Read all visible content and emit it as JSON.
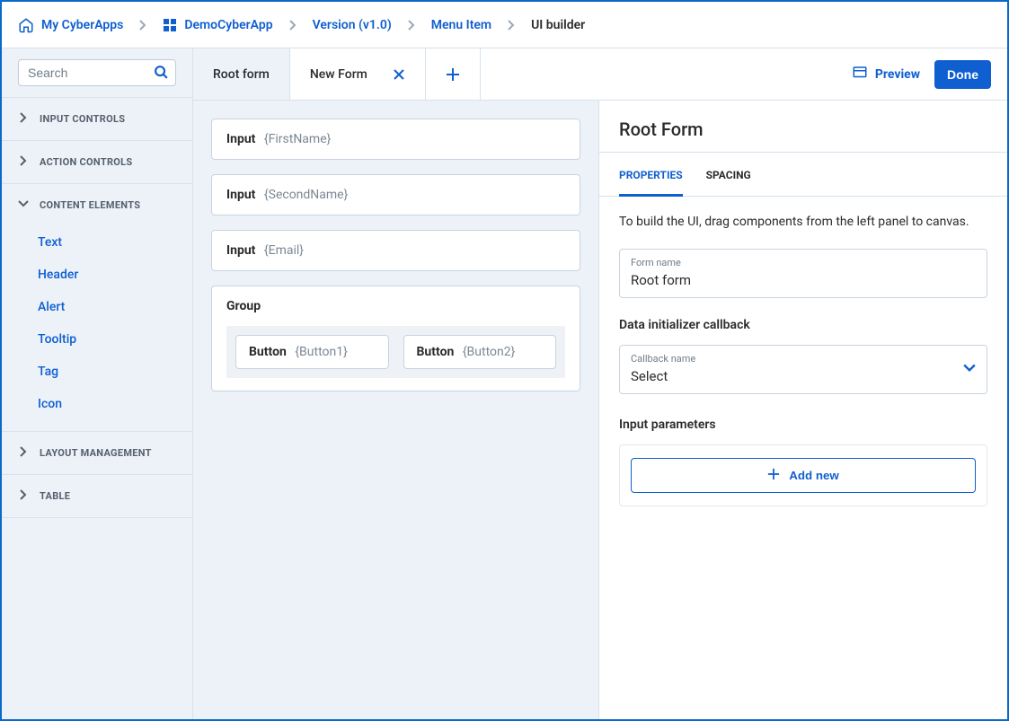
{
  "breadcrumb": {
    "items": [
      {
        "label": "My CyberApps"
      },
      {
        "label": "DemoCyberApp"
      },
      {
        "label": "Version (v1.0)"
      },
      {
        "label": "Menu Item"
      },
      {
        "label": "UI builder"
      }
    ]
  },
  "sidebar": {
    "search_placeholder": "Search",
    "sections": [
      {
        "label": "Input controls",
        "expanded": false
      },
      {
        "label": "Action controls",
        "expanded": false
      },
      {
        "label": "Content elements",
        "expanded": true,
        "items": [
          "Text",
          "Header",
          "Alert",
          "Tooltip",
          "Tag",
          "Icon"
        ]
      },
      {
        "label": "Layout management",
        "expanded": false
      },
      {
        "label": "Table",
        "expanded": false
      }
    ]
  },
  "tabs": {
    "items": [
      {
        "label": "Root form",
        "closable": false,
        "active": true
      },
      {
        "label": "New Form",
        "closable": true,
        "active": false
      }
    ]
  },
  "topright": {
    "preview": "Preview",
    "done": "Done"
  },
  "canvas": {
    "inputs": [
      {
        "type": "Input",
        "binding": "{FirstName}"
      },
      {
        "type": "Input",
        "binding": "{SecondName}"
      },
      {
        "type": "Input",
        "binding": "{Email}"
      }
    ],
    "group": {
      "title": "Group",
      "buttons": [
        {
          "type": "Button",
          "binding": "{Button1}"
        },
        {
          "type": "Button",
          "binding": "{Button2}"
        }
      ]
    }
  },
  "properties": {
    "title": "Root Form",
    "tabs": {
      "properties": "Properties",
      "spacing": "Spacing"
    },
    "hint": "To build the UI, drag components from the left panel to canvas.",
    "form_name_label": "Form name",
    "form_name_value": "Root form",
    "callback_section": "Data initializer callback",
    "callback_label": "Callback name",
    "callback_value": "Select",
    "input_params": "Input parameters",
    "add_new": "Add new"
  }
}
